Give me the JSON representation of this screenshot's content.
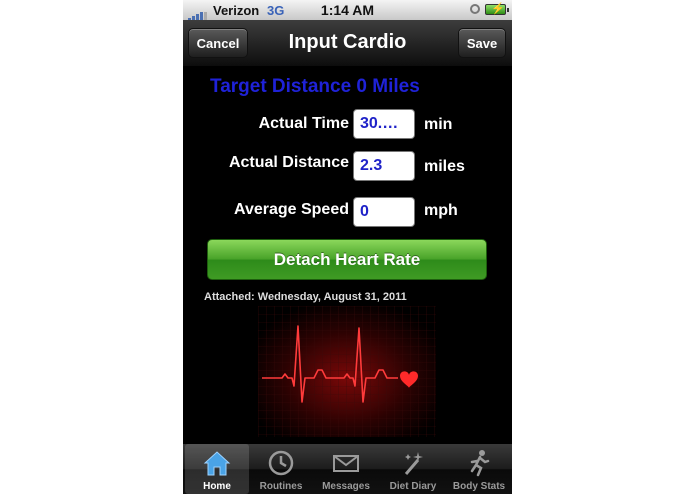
{
  "status_bar": {
    "carrier": "Verizon",
    "network": "3G",
    "time": "1:14 AM"
  },
  "nav": {
    "cancel_label": "Cancel",
    "title": "Input Cardio",
    "save_label": "Save"
  },
  "target_text": "Target Distance 0 Miles",
  "form": {
    "time": {
      "label": "Actual Time",
      "value": "30.…",
      "unit": "min"
    },
    "distance": {
      "label": "Actual Distance",
      "value": "2.3",
      "unit": "miles"
    },
    "speed": {
      "label": "Average Speed",
      "value": "0",
      "unit": "mph"
    }
  },
  "detach_label": "Detach Heart Rate",
  "attached_text": "Attached: Wednesday, August 31, 2011",
  "colors": {
    "accent_blue": "#1f22d8",
    "button_green": "#4aa42a",
    "ecg_red": "#ff2a2a"
  },
  "tabs": [
    {
      "label": "Home",
      "icon": "home-icon",
      "active": true
    },
    {
      "label": "Routines",
      "icon": "clock-icon",
      "active": false
    },
    {
      "label": "Messages",
      "icon": "envelope-icon",
      "active": false
    },
    {
      "label": "Diet Diary",
      "icon": "magic-wand-icon",
      "active": false
    },
    {
      "label": "Body Stats",
      "icon": "runner-icon",
      "active": false
    }
  ]
}
